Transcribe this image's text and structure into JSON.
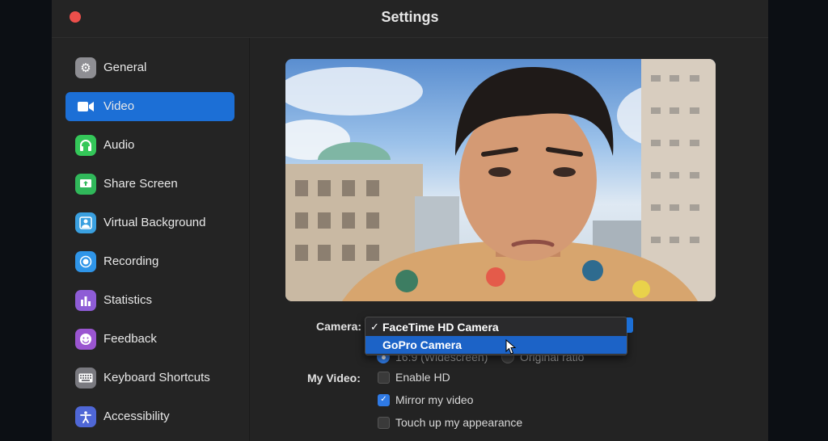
{
  "window": {
    "title": "Settings"
  },
  "sidebar": {
    "items": [
      {
        "label": "General",
        "icon": "gear-icon",
        "color": "#8e8e93",
        "glyph": "⚙"
      },
      {
        "label": "Video",
        "icon": "video-camera-icon",
        "color": "#1c6fd6",
        "glyph": "▶",
        "active": true
      },
      {
        "label": "Audio",
        "icon": "headphones-icon",
        "color": "#34c759",
        "glyph": "∩"
      },
      {
        "label": "Share Screen",
        "icon": "share-screen-icon",
        "color": "#30b85a",
        "glyph": "↑"
      },
      {
        "label": "Virtual Background",
        "icon": "person-background-icon",
        "color": "#3aa0e0",
        "glyph": "☻"
      },
      {
        "label": "Recording",
        "icon": "record-icon",
        "color": "#2f95e8",
        "glyph": "◉"
      },
      {
        "label": "Statistics",
        "icon": "bar-chart-icon",
        "color": "#8e5cd6",
        "glyph": "▮"
      },
      {
        "label": "Feedback",
        "icon": "smiley-icon",
        "color": "#9a55d0",
        "glyph": "☺"
      },
      {
        "label": "Keyboard Shortcuts",
        "icon": "keyboard-icon",
        "color": "#7a7a80",
        "glyph": "⌨"
      },
      {
        "label": "Accessibility",
        "icon": "accessibility-icon",
        "color": "#4f67d6",
        "glyph": "♿"
      }
    ]
  },
  "camera": {
    "label": "Camera:",
    "options": [
      {
        "label": "FaceTime HD Camera",
        "checked": true
      },
      {
        "label": "GoPro Camera",
        "highlighted": true
      }
    ]
  },
  "ratio": {
    "widescreen_label": "16:9 (Widescreen)",
    "original_label": "Original ratio"
  },
  "my_video": {
    "label": "My Video:",
    "options": [
      {
        "label": "Enable HD",
        "checked": false
      },
      {
        "label": "Mirror my video",
        "checked": true
      },
      {
        "label": "Touch up my appearance",
        "checked": false
      }
    ]
  }
}
